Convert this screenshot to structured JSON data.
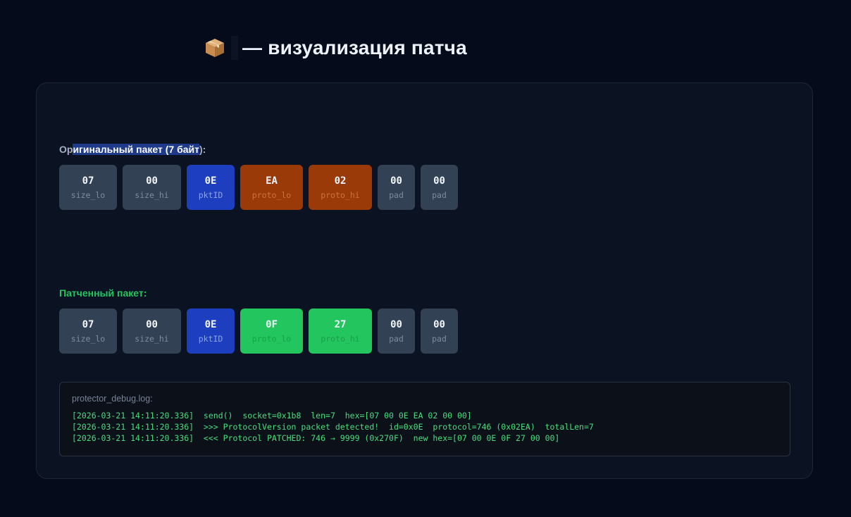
{
  "header": {
    "icon": "package-icon",
    "title": "— визуализация патча"
  },
  "original": {
    "label_before": "Ор",
    "label_highlight": "игинальный пакет (7 байт",
    "label_after": "):",
    "bytes": [
      {
        "value": "07",
        "name": "size_lo",
        "color": "#334155"
      },
      {
        "value": "00",
        "name": "size_hi",
        "color": "#334155"
      },
      {
        "value": "0E",
        "name": "pktID",
        "color": "#1d3fbf"
      },
      {
        "value": "EA",
        "name": "proto_lo",
        "color": "#9a3a08"
      },
      {
        "value": "02",
        "name": "proto_hi",
        "color": "#9a3a08"
      },
      {
        "value": "00",
        "name": "pad",
        "color": "#334155"
      },
      {
        "value": "00",
        "name": "pad",
        "color": "#334155"
      }
    ]
  },
  "patched": {
    "label": "Патченный пакет:",
    "bytes": [
      {
        "value": "07",
        "name": "size_lo",
        "color": "#334155"
      },
      {
        "value": "00",
        "name": "size_hi",
        "color": "#334155"
      },
      {
        "value": "0E",
        "name": "pktID",
        "color": "#1d3fbf"
      },
      {
        "value": "0F",
        "name": "proto_lo",
        "color": "#22c55e"
      },
      {
        "value": "27",
        "name": "proto_hi",
        "color": "#22c55e"
      },
      {
        "value": "00",
        "name": "pad",
        "color": "#334155"
      },
      {
        "value": "00",
        "name": "pad",
        "color": "#334155"
      }
    ]
  },
  "log": {
    "title": "protector_debug.log:",
    "lines": [
      "[2026-03-21 14:11:20.336]  send()  socket=0x1b8  len=7  hex=[07 00 0E EA 02 00 00]",
      "[2026-03-21 14:11:20.336]  >>> ProtocolVersion packet detected!  id=0x0E  protocol=746 (0x02EA)  totalLen=7",
      "[2026-03-21 14:11:20.336]  <<< Protocol PATCHED: 746 → 9999 (0x270F)  new hex=[07 00 0E 0F 27 00 00]"
    ]
  },
  "colors": {
    "background": "#050b1a",
    "panel": "#0b1222",
    "accent_green": "#22c55e",
    "accent_blue": "#1d3fbf",
    "accent_orange": "#9a3a08",
    "neutral_byte": "#334155"
  }
}
